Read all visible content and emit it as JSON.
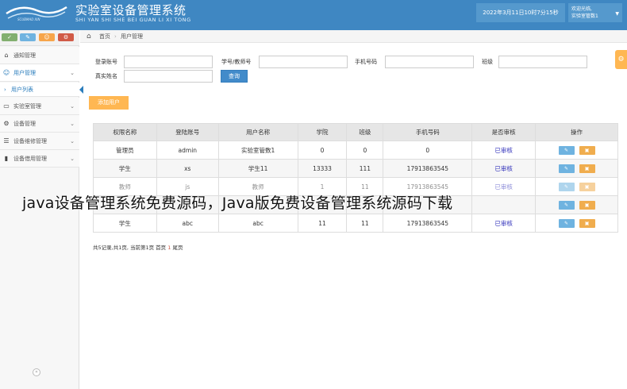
{
  "header": {
    "logo_word": "SCUBMAD XIN",
    "title": "实验室设备管理系统",
    "subtitle": "SHI YAN SHI SHE BEI GUAN LI XI TONG",
    "date": "2022年3月11日10时7分15秒",
    "welcome": "欢迎光临,",
    "user": "实验室管数1"
  },
  "shortcuts": [
    "✓",
    "✎",
    "☺",
    "⚙"
  ],
  "sidebar": {
    "items": [
      {
        "label": "通知管理",
        "icon": "home-icon"
      },
      {
        "label": "用户管理",
        "icon": "users-icon"
      },
      {
        "label": "实验室管理",
        "icon": "desktop-icon"
      },
      {
        "label": "设备管理",
        "icon": "gears-icon"
      },
      {
        "label": "设备维修管理",
        "icon": "list-icon"
      },
      {
        "label": "设备借用管理",
        "icon": "bookmark-icon"
      }
    ],
    "sub_active": "用户列表"
  },
  "breadcrumb": {
    "home": "首页",
    "current": "用户管理"
  },
  "search": {
    "login_label": "登录账号",
    "studentno_label": "学号/教师号",
    "phone_label": "手机号码",
    "class_label": "班级",
    "realname_label": "真实姓名",
    "query_button": "查询",
    "add_button": "添加用户"
  },
  "table": {
    "headers": [
      "权限名称",
      "登陆账号",
      "用户名称",
      "学院",
      "班级",
      "手机号码",
      "是否审核",
      "操作"
    ],
    "rows": [
      [
        "管理员",
        "admin",
        "实验室管数1",
        "0",
        "0",
        "0",
        "已审核"
      ],
      [
        "学生",
        "xs",
        "学生11",
        "13333",
        "111",
        "17913863545",
        "已审核"
      ],
      [
        "教师",
        "js",
        "教师",
        "1",
        "11",
        "17913863545",
        "已审核"
      ],
      [
        "",
        "",
        "",
        "",
        "",
        "",
        ""
      ],
      [
        "学生",
        "abc",
        "abc",
        "11",
        "11",
        "17913863545",
        "已审核"
      ]
    ],
    "edit_icon": "✎",
    "delete_icon": "▣"
  },
  "pagination": {
    "prefix": "共5记录,共1页, 当前第1页 首页",
    "current": "1",
    "suffix": "尾页"
  },
  "overlay_text": "java设备管理系统免费源码，Java版免费设备管理系统源码下载"
}
